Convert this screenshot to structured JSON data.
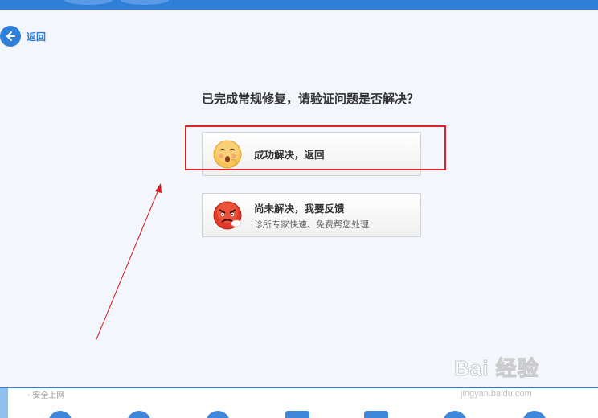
{
  "nav": {
    "back_label": "返回"
  },
  "repair": {
    "question": "已完成常规修复，请验证问题是否解决？",
    "options": [
      {
        "title": "成功解决，返回",
        "subtitle": "",
        "icon": "happy-face-icon"
      },
      {
        "title": "尚未解决，我要反馈",
        "subtitle": "诊所专家快速、免费帮您处理",
        "icon": "angry-face-icon"
      }
    ]
  },
  "bottom": {
    "label": "· 安全上网"
  },
  "watermark": {
    "logo": "Bai 经验",
    "url": "jingyan.baidu.com"
  },
  "colors": {
    "accent": "#2f7ed8",
    "highlight": "#e0202a",
    "annotation_arrow": "#d4161e"
  }
}
